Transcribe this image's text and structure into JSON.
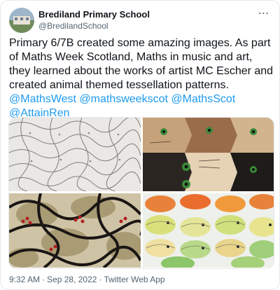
{
  "account": {
    "name": "Brediland Primary School",
    "handle": "@BredilandSchool",
    "more_icon": "more-horizontal-icon"
  },
  "tweet": {
    "text": "Primary 6/7B created some amazing images. As part of Maths Week Scotland, Maths in music and art, they learned about the works of artist MC Escher and created animal themed tessellation patterns.",
    "mentions": [
      "@MathsWest",
      "@mathsweekscot",
      "@MathsScot",
      "@AttainRen"
    ]
  },
  "media": {
    "count": 4,
    "descriptions": [
      "pencil-sketch-tessellation",
      "cat-face-tessellation",
      "dark-bird-tessellation",
      "colourful-fish-tessellation"
    ]
  },
  "meta": {
    "time": "9:32 AM",
    "date": "Sep 28, 2022",
    "source": "Twitter Web App",
    "separator": "·"
  },
  "colors": {
    "text": "#0f1419",
    "secondary": "#536471",
    "link": "#1d9bf0",
    "border": "#e6e9ec"
  }
}
